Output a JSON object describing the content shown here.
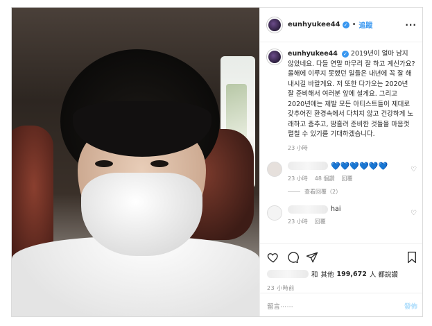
{
  "header": {
    "username": "eunhyukee44",
    "follow_label": "追蹤",
    "more_label": "···"
  },
  "caption": {
    "username": "eunhyukee44",
    "text": "2019년이 얼마 남지 않았네요. 다들 연말 마무리 잘 하고 계신가요? 올해에 이루지 못했던 일들은 내년에 꼭 잘 해내시길 바랄게요. 저 또한 다가오는 2020년 잘 준비해서 여러분 앞에 설게요. 그리고 2020년에는 제발 모든 아티스트들이 제대로 갖추어진 환경속에서 다치지 않고 건강하게 노래하고 춤추고, 땀흘려 준비한 것들을 마음껏 펼칠 수 있기를 기대하겠습니다.",
    "time": "23 小時"
  },
  "comments": [
    {
      "text": "💙💙💙💙💙💙",
      "time": "23 小時",
      "likes": "48 個讚",
      "reply_label": "回覆",
      "view_replies": "查看回覆（2）"
    },
    {
      "text": "hai",
      "time": "23 小時",
      "reply_label": "回覆"
    }
  ],
  "likes": {
    "prefix": "和",
    "others_label": "其他",
    "count": "199,672",
    "suffix": "人 都說讚"
  },
  "post_time": "23 小時前",
  "add_comment": {
    "placeholder": "留言⋯⋯",
    "send_label": "發佈"
  },
  "colors": {
    "accent": "#3897f0",
    "muted": "#8e8e8e",
    "send_disabled": "#b2dffc"
  },
  "icons": [
    "heart-icon",
    "comment-icon",
    "share-icon",
    "bookmark-icon",
    "verified-badge-icon",
    "more-icon"
  ]
}
